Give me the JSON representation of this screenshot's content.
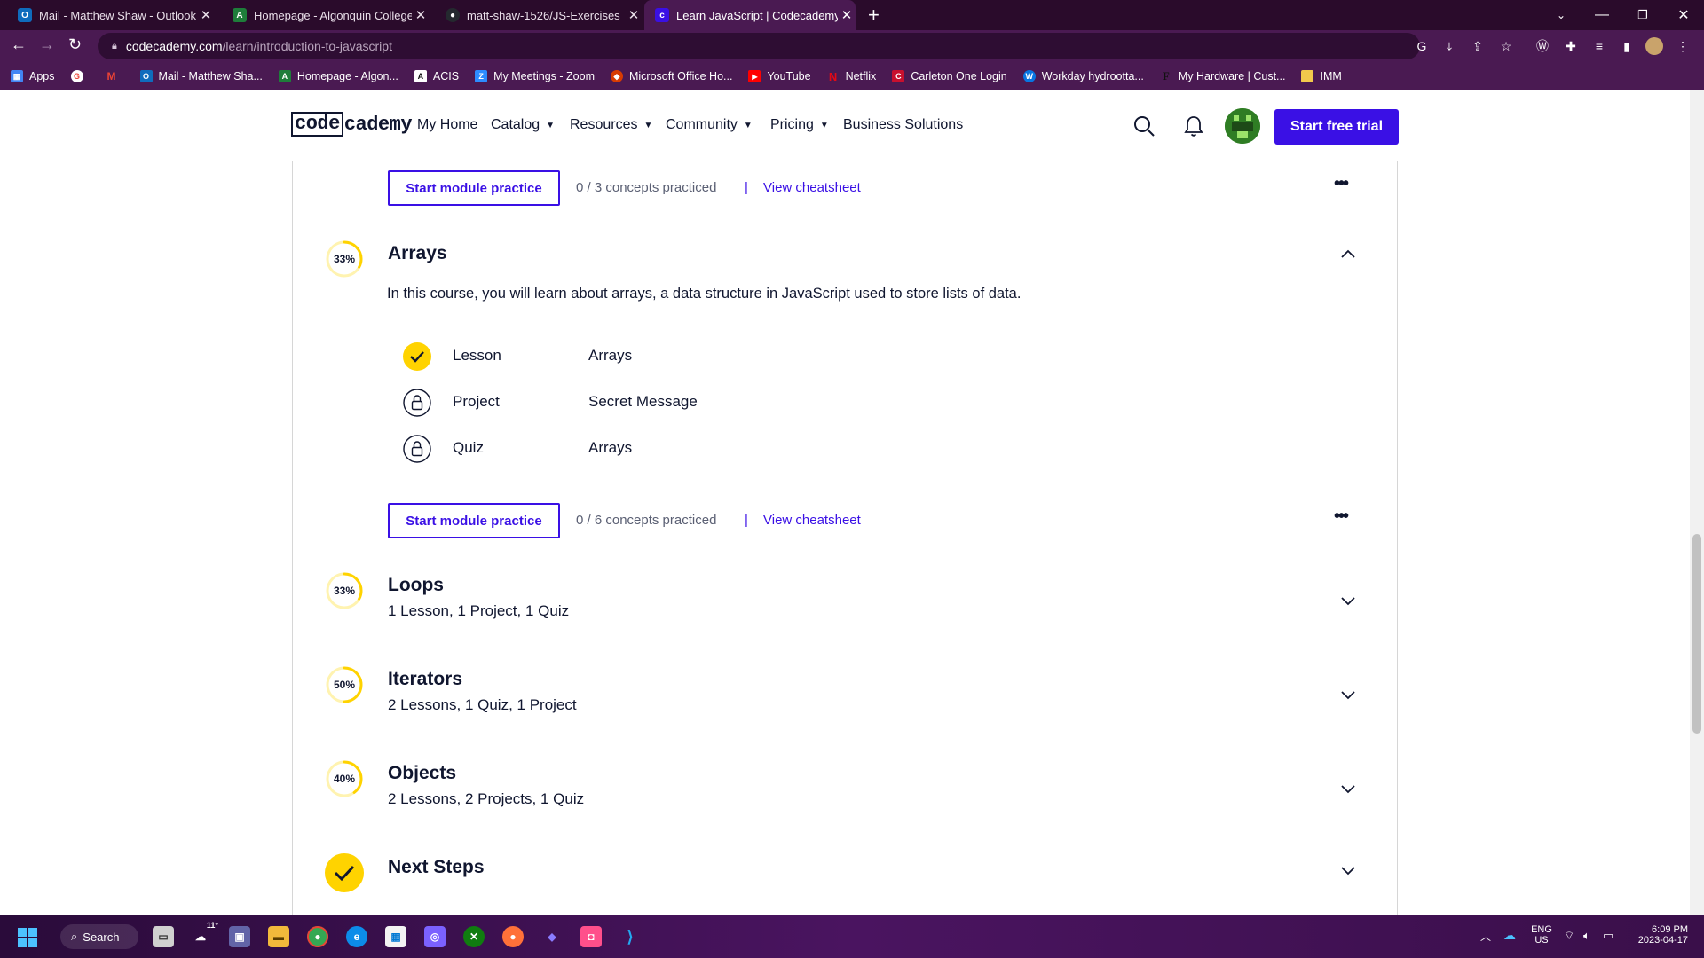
{
  "browser": {
    "tabs": [
      {
        "title": "Mail - Matthew Shaw - Outlook",
        "icon": "outlook-icon",
        "color": "#0f6cbd",
        "glyph": "O"
      },
      {
        "title": "Homepage - Algonquin College",
        "icon": "algonquin-icon",
        "color": "#1e7d3a",
        "glyph": "A"
      },
      {
        "title": "matt-shaw-1526/JS-Exercises",
        "icon": "github-icon",
        "color": "#24292f",
        "glyph": "●"
      },
      {
        "title": "Learn JavaScript | Codecademy",
        "icon": "codecademy-icon",
        "color": "#3a10e5",
        "glyph": "c"
      }
    ],
    "new_tab": "+",
    "url_host": "codecademy.com",
    "url_path": "/learn/introduction-to-javascript",
    "bookmarks": [
      {
        "label": "Apps",
        "icon": "apps-grid-icon",
        "color": "#4285f4",
        "glyph": "▦"
      },
      {
        "label": "",
        "icon": "google-icon",
        "color": "#ea4335",
        "glyph": "G"
      },
      {
        "label": "",
        "icon": "gmail-icon",
        "color": "#ea4335",
        "glyph": "M"
      },
      {
        "label": "Mail - Matthew Sha...",
        "icon": "outlook-icon",
        "color": "#0f6cbd",
        "glyph": "O"
      },
      {
        "label": "Homepage - Algon...",
        "icon": "algonquin-icon",
        "color": "#1e7d3a",
        "glyph": "A"
      },
      {
        "label": "ACIS",
        "icon": "acis-icon",
        "color": "#111111",
        "glyph": "A"
      },
      {
        "label": "My Meetings - Zoom",
        "icon": "zoom-icon",
        "color": "#2d8cff",
        "glyph": "Z"
      },
      {
        "label": "Microsoft Office Ho...",
        "icon": "office-icon",
        "color": "#d83b01",
        "glyph": "◆"
      },
      {
        "label": "YouTube",
        "icon": "youtube-icon",
        "color": "#ff0000",
        "glyph": "▶"
      },
      {
        "label": "Netflix",
        "icon": "netflix-icon",
        "color": "#e50914",
        "glyph": "N"
      },
      {
        "label": "Carleton One Login",
        "icon": "carleton-icon",
        "color": "#c8102e",
        "glyph": "C"
      },
      {
        "label": "Workday hydrootta...",
        "icon": "workday-icon",
        "color": "#0875e1",
        "glyph": "W"
      },
      {
        "label": "My Hardware | Cust...",
        "icon": "hardware-icon",
        "color": "#222222",
        "glyph": "F"
      },
      {
        "label": "IMM",
        "icon": "folder-icon",
        "color": "#f2c94c",
        "glyph": ""
      }
    ]
  },
  "site": {
    "logo_boxed": "code",
    "logo_rest": "cademy",
    "nav": [
      {
        "label": "My Home",
        "dropdown": false
      },
      {
        "label": "Catalog",
        "dropdown": true
      },
      {
        "label": "Resources",
        "dropdown": true
      },
      {
        "label": "Community",
        "dropdown": true
      },
      {
        "label": "Pricing",
        "dropdown": true
      },
      {
        "label": "Business Solutions",
        "dropdown": false
      }
    ],
    "cta": "Start free trial",
    "accent": "#3a10e5",
    "progress_color": "#ffd300"
  },
  "prev_module_footer": {
    "practice_button": "Start module practice",
    "concepts": "0 / 3 concepts practiced",
    "separator": "|",
    "cheatsheet": "View cheatsheet"
  },
  "arrays_module": {
    "progress_label": "33%",
    "progress": 0.33,
    "title": "Arrays",
    "description": "In this course, you will learn about arrays, a data structure in JavaScript used to store lists of data.",
    "items": [
      {
        "type": "Lesson",
        "name": "Arrays",
        "status": "complete"
      },
      {
        "type": "Project",
        "name": "Secret Message",
        "status": "locked"
      },
      {
        "type": "Quiz",
        "name": "Arrays",
        "status": "locked"
      }
    ],
    "practice_button": "Start module practice",
    "concepts": "0 / 6 concepts practiced",
    "separator": "|",
    "cheatsheet": "View cheatsheet"
  },
  "collapsed_modules": [
    {
      "progress_label": "33%",
      "progress": 0.33,
      "title": "Loops",
      "summary": "1 Lesson, 1 Project, 1 Quiz"
    },
    {
      "progress_label": "50%",
      "progress": 0.5,
      "title": "Iterators",
      "summary": "2 Lessons, 1 Quiz, 1 Project"
    },
    {
      "progress_label": "40%",
      "progress": 0.4,
      "title": "Objects",
      "summary": "2 Lessons, 2 Projects, 1 Quiz"
    }
  ],
  "next_steps": {
    "title": "Next Steps",
    "complete": true
  },
  "taskbar": {
    "search_label": "Search",
    "weather_badge": "11°",
    "language": "ENG",
    "region": "US",
    "time": "6:09 PM",
    "date": "2023-04-17"
  }
}
